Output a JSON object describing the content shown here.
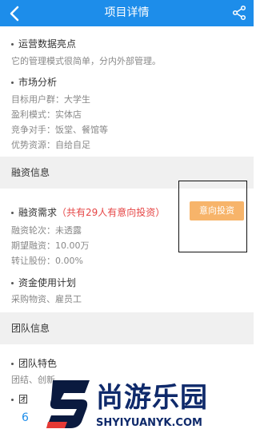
{
  "header": {
    "title": "项目详情",
    "back_icon": "back-arrow-icon",
    "share_icon": "share-icon",
    "bg_color": "#1d8dea"
  },
  "operations": {
    "title": "运营数据亮点",
    "text": "它的管理模式很简单，分内外部管理。"
  },
  "market": {
    "title": "市场分析",
    "lines": [
      "目标用户群：大学生",
      "盈利模式：实体店",
      "竞争对手：饭堂、餐馆等",
      "优势资源：自给自足"
    ]
  },
  "financing": {
    "section_title": "融资信息",
    "need_title": "融资需求",
    "need_note": "（共有29人有意向投资）",
    "invest_button": "意向投资",
    "lines": [
      "融资轮次：未透露",
      "期望融资：10.00万",
      "转让股份：0.00%"
    ],
    "fund_use_title": "资金使用计划",
    "fund_use_text": "采购物资、雇员工"
  },
  "team": {
    "section_title": "团队信息",
    "feature_title": "团队特色",
    "feature_text": "团结、创新",
    "member_title": "团",
    "page_number": "6"
  },
  "watermark": {
    "text": "尚游乐园",
    "url": "SHYIYUANYK.COM"
  }
}
